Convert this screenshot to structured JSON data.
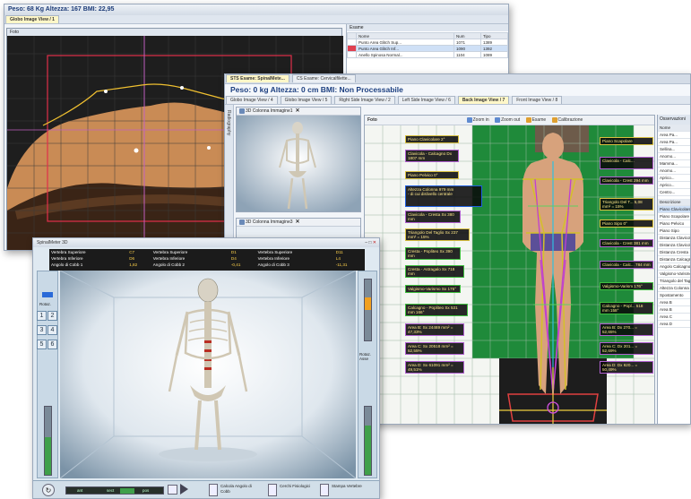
{
  "back_window": {
    "title": "Peso: 68 Kg Altezza: 167 BMI: 22,95",
    "tab": "Globo Image View / 1",
    "pane_label": "Foto",
    "right_pane_title": "Esame",
    "table_headers": [
      "Nome",
      "Num",
      "Tipo"
    ],
    "table_rows": [
      [
        "Punto Area Glitch Sup...",
        "1071",
        "1389"
      ],
      [
        "Punto Area Glitch Inf...",
        "1090",
        "1392"
      ],
      [
        "Anello Spinosa Normal...",
        "1104",
        "1089"
      ]
    ]
  },
  "mid_window": {
    "title_tabs": [
      "STS Esame: SpinalMete...",
      "CS Esame: Cervicalfilette..."
    ],
    "header": "Peso: 0 kg Altezza: 0 cm BMI: Non Processabile",
    "view_tabs": [
      "Globo Image View / 4",
      "Globo Image View / 5",
      "Right Side Image View / 2",
      "Left Side Image View / 6",
      "Back Image View / 7",
      "Front Image View / 8"
    ],
    "foto_label": "Foto",
    "toolbar": [
      "Zoom in",
      "Zoom out",
      "Esame",
      "Calibrazione"
    ],
    "sidebar_label": "Radiography",
    "mini_views": [
      "3D Colonna Immagine1",
      "3D Colonna Immagine3"
    ],
    "labels_left": [
      "Piano Clavicolare 2°",
      "Clavicola - Calcagno Dx 1807 mm",
      "Piano Pelvico 0°",
      "Altezza Colonna 979 mm\n- di cui dislivello centrale",
      "Clavicola - Cresta Sx 380 mm",
      "Triangolo Del Taglio Sx 237 mm² = 15%",
      "Cresta - Popliteo Sx 390 mm",
      "Cresta - Astragalo Sx 718 mm",
      "Valgismo-Varismo Sx 175°",
      "Calcagno - Popliteo Sx 531 mm 166°",
      "Area B: Sx 24469 mm² = 47,33%",
      "Area C: Sx 20518 mm² = 52,55%",
      "Area D: Sx 61091 mm² = 49,51%"
    ],
    "labels_right": [
      "Piano Scapolare",
      "Clavicola - Calc...",
      "Clavicola - Crest 294 mm",
      "Triangolo Del T... 5,08 mm² = 15%",
      "Piano Sipo 0°",
      "Clavicola - Crest 381 mm",
      "Clavicola - Calc... 784 mm",
      "Valgismo-Varism 176°",
      "Calcagno - Popl... 518 mm 158°",
      "Area B: Dx 270... = 52,65%",
      "Area C: Dx 201... = 52,69%",
      "Area D: Dx 620... = 50,49%"
    ],
    "right_panel_title": "Osservazioni",
    "right_panel_top": [
      "Nome",
      "Area Pa...",
      "Area Pa...",
      "Sellina...",
      "Anomo...",
      "Mamma...",
      "Anomo...",
      "Aprico...",
      "Aprico...",
      "Centro..."
    ],
    "right_panel_header": "Descrizione",
    "right_panel_items": [
      "Piano Clavicolare",
      "Piano Scapolare",
      "Piano Pelvico",
      "Piano Sipo",
      "Distanza Clavicola",
      "Distanza Clavicola",
      "Distanza Cresta",
      "Distanza Calcagno",
      "Angolo Calcagno",
      "Valgismo-Varismo",
      "Triangolo del Taglio",
      "Altezza Colonna",
      "Spostamento",
      "Area B",
      "Area B",
      "Area C",
      "Area D"
    ]
  },
  "front_window": {
    "title": "SpinalMeter 3D",
    "metric_rows": [
      [
        "Vertebra Superiore",
        "C7",
        "Vertebra Superiore",
        "D1",
        "Vertebra Superiore",
        "D11"
      ],
      [
        "Vertebra Inferiore",
        "D6",
        "Vertebra Inferiore",
        "D4",
        "Vertebra Inferiore",
        "L4"
      ],
      [
        "Angolo di Cobb 1",
        "1,82",
        "Angolo di Cobb 2",
        "-0,41",
        "Angolo di Cobb 3",
        "-11,31"
      ]
    ],
    "left_panel_label": "Rotaz.",
    "num_buttons": [
      "1",
      "2",
      "3",
      "4",
      "5",
      "6"
    ],
    "right_label": "Rotaz. Asse",
    "bottom_buttons": [
      "Calcola Angolo di Cobb",
      "Cerchi Fisiologici",
      "Stampa Vertebre"
    ],
    "slider_labels": [
      "ant",
      "sect",
      "pos"
    ]
  }
}
